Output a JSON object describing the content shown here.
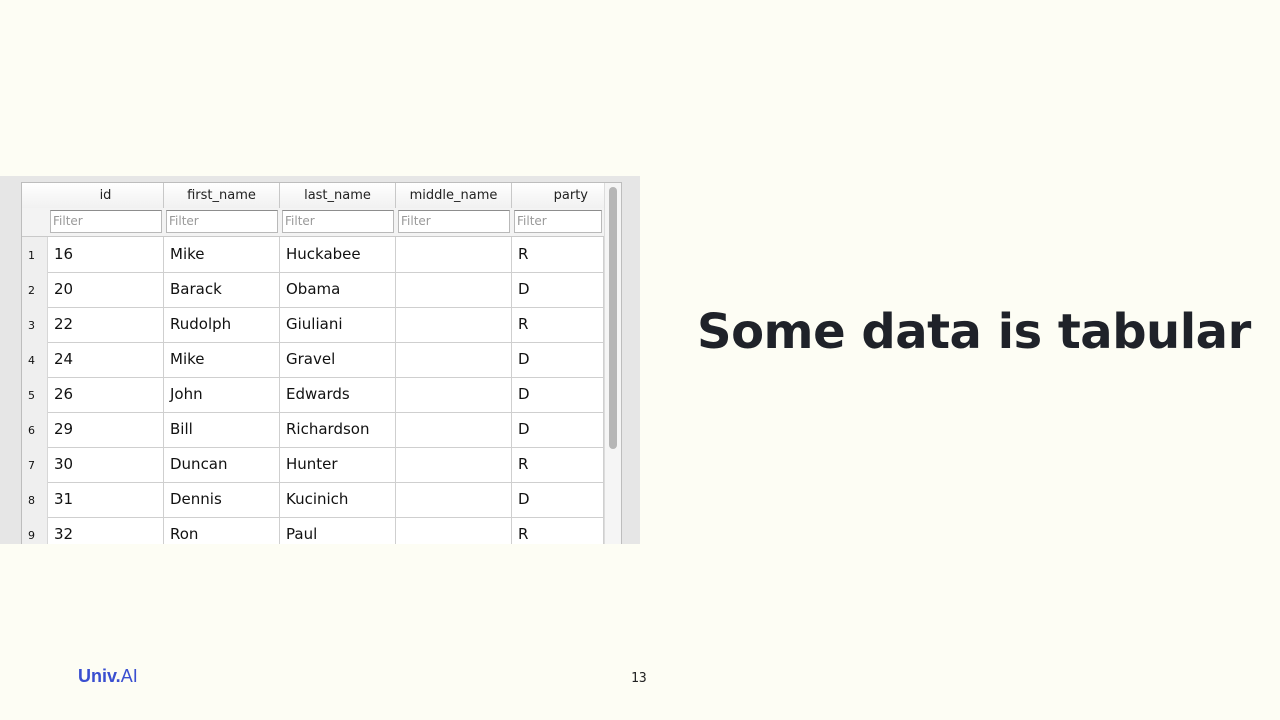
{
  "slide": {
    "title": "Some data is tabular",
    "page_number": "13",
    "logo": {
      "main": "Univ",
      "dot": ".",
      "suffix": "AI"
    }
  },
  "table": {
    "columns": [
      "id",
      "first_name",
      "last_name",
      "middle_name",
      "party"
    ],
    "filter_placeholder": "Filter",
    "rows": [
      {
        "n": "1",
        "id": "16",
        "first_name": "Mike",
        "last_name": "Huckabee",
        "middle_name": "",
        "party": "R"
      },
      {
        "n": "2",
        "id": "20",
        "first_name": "Barack",
        "last_name": "Obama",
        "middle_name": "",
        "party": "D"
      },
      {
        "n": "3",
        "id": "22",
        "first_name": "Rudolph",
        "last_name": "Giuliani",
        "middle_name": "",
        "party": "R"
      },
      {
        "n": "4",
        "id": "24",
        "first_name": "Mike",
        "last_name": "Gravel",
        "middle_name": "",
        "party": "D"
      },
      {
        "n": "5",
        "id": "26",
        "first_name": "John",
        "last_name": "Edwards",
        "middle_name": "",
        "party": "D"
      },
      {
        "n": "6",
        "id": "29",
        "first_name": "Bill",
        "last_name": "Richardson",
        "middle_name": "",
        "party": "D"
      },
      {
        "n": "7",
        "id": "30",
        "first_name": "Duncan",
        "last_name": "Hunter",
        "middle_name": "",
        "party": "R"
      },
      {
        "n": "8",
        "id": "31",
        "first_name": "Dennis",
        "last_name": "Kucinich",
        "middle_name": "",
        "party": "D"
      },
      {
        "n": "9",
        "id": "32",
        "first_name": "Ron",
        "last_name": "Paul",
        "middle_name": "",
        "party": "R"
      }
    ]
  }
}
